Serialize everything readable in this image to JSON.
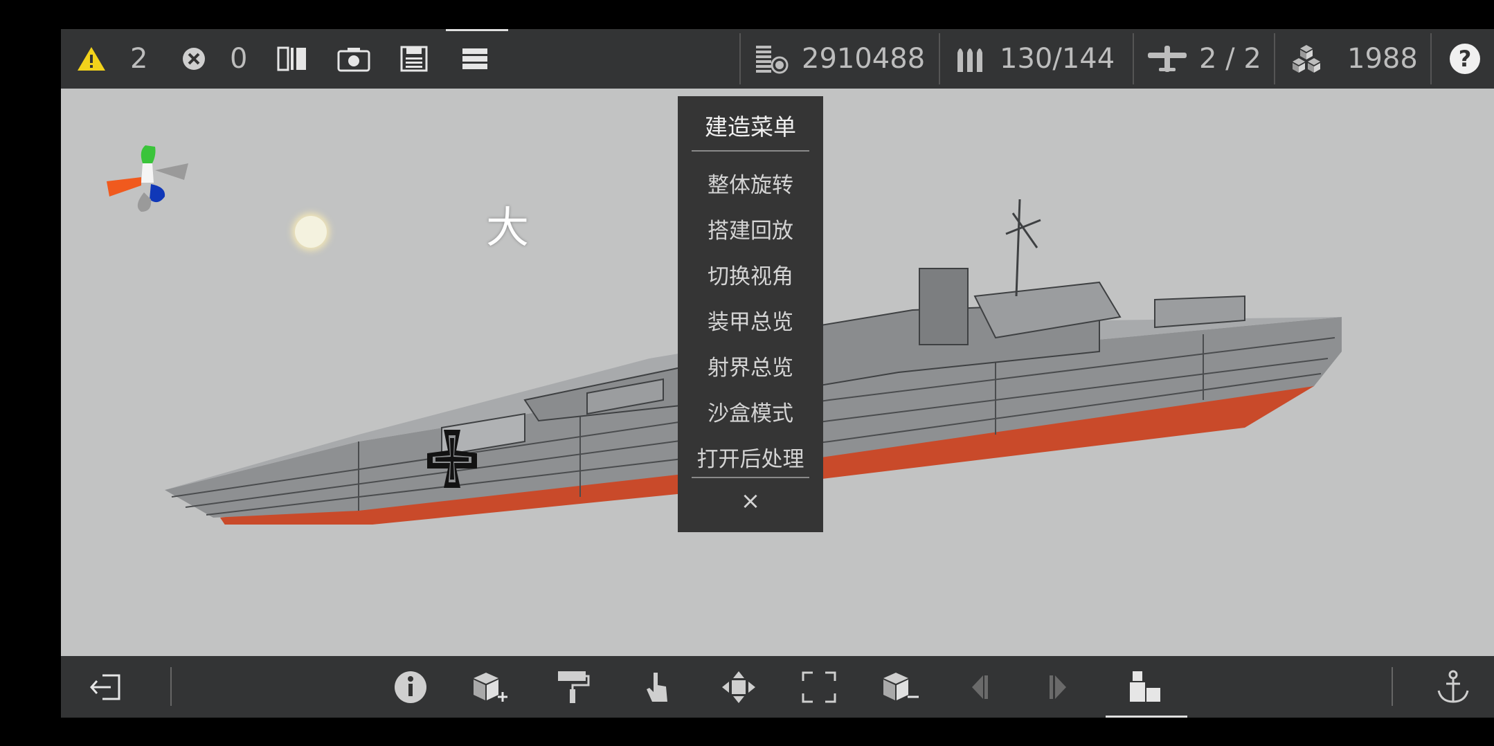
{
  "topbar": {
    "warning_count": "2",
    "error_count": "0",
    "cost": "2910488",
    "ammo": "130/144",
    "aircraft": "2 / 2",
    "parts": "1988",
    "icons": [
      "warning-icon",
      "error-icon",
      "mirror-icon",
      "camera-icon",
      "save-icon",
      "menu-icon",
      "cost-icon",
      "ammo-icon",
      "aircraft-icon",
      "parts-icon",
      "help-icon"
    ],
    "help_label": "?"
  },
  "viewport": {
    "size_label": "大"
  },
  "build_menu": {
    "title": "建造菜单",
    "items": [
      "整体旋转",
      "搭建回放",
      "切换视角",
      "装甲总览",
      "射界总览",
      "沙盒模式",
      "打开后处理"
    ],
    "close_label": "×"
  },
  "bottombar": {
    "icons": [
      "exit-icon",
      "info-icon",
      "add-block-icon",
      "paint-roller-icon",
      "hand-icon",
      "move-icon",
      "fullscreen-icon",
      "remove-block-icon",
      "prev-icon",
      "next-icon",
      "vehicle-icon",
      "anchor-icon"
    ]
  },
  "colors": {
    "bar": "#333435",
    "viewport": "#c2c3c3",
    "hull_gray": "#8d8f90",
    "hull_red": "#c94a2a",
    "axis_green": "#2fbf2f",
    "axis_orange": "#e85a1e",
    "axis_blue": "#1a3fb0"
  }
}
